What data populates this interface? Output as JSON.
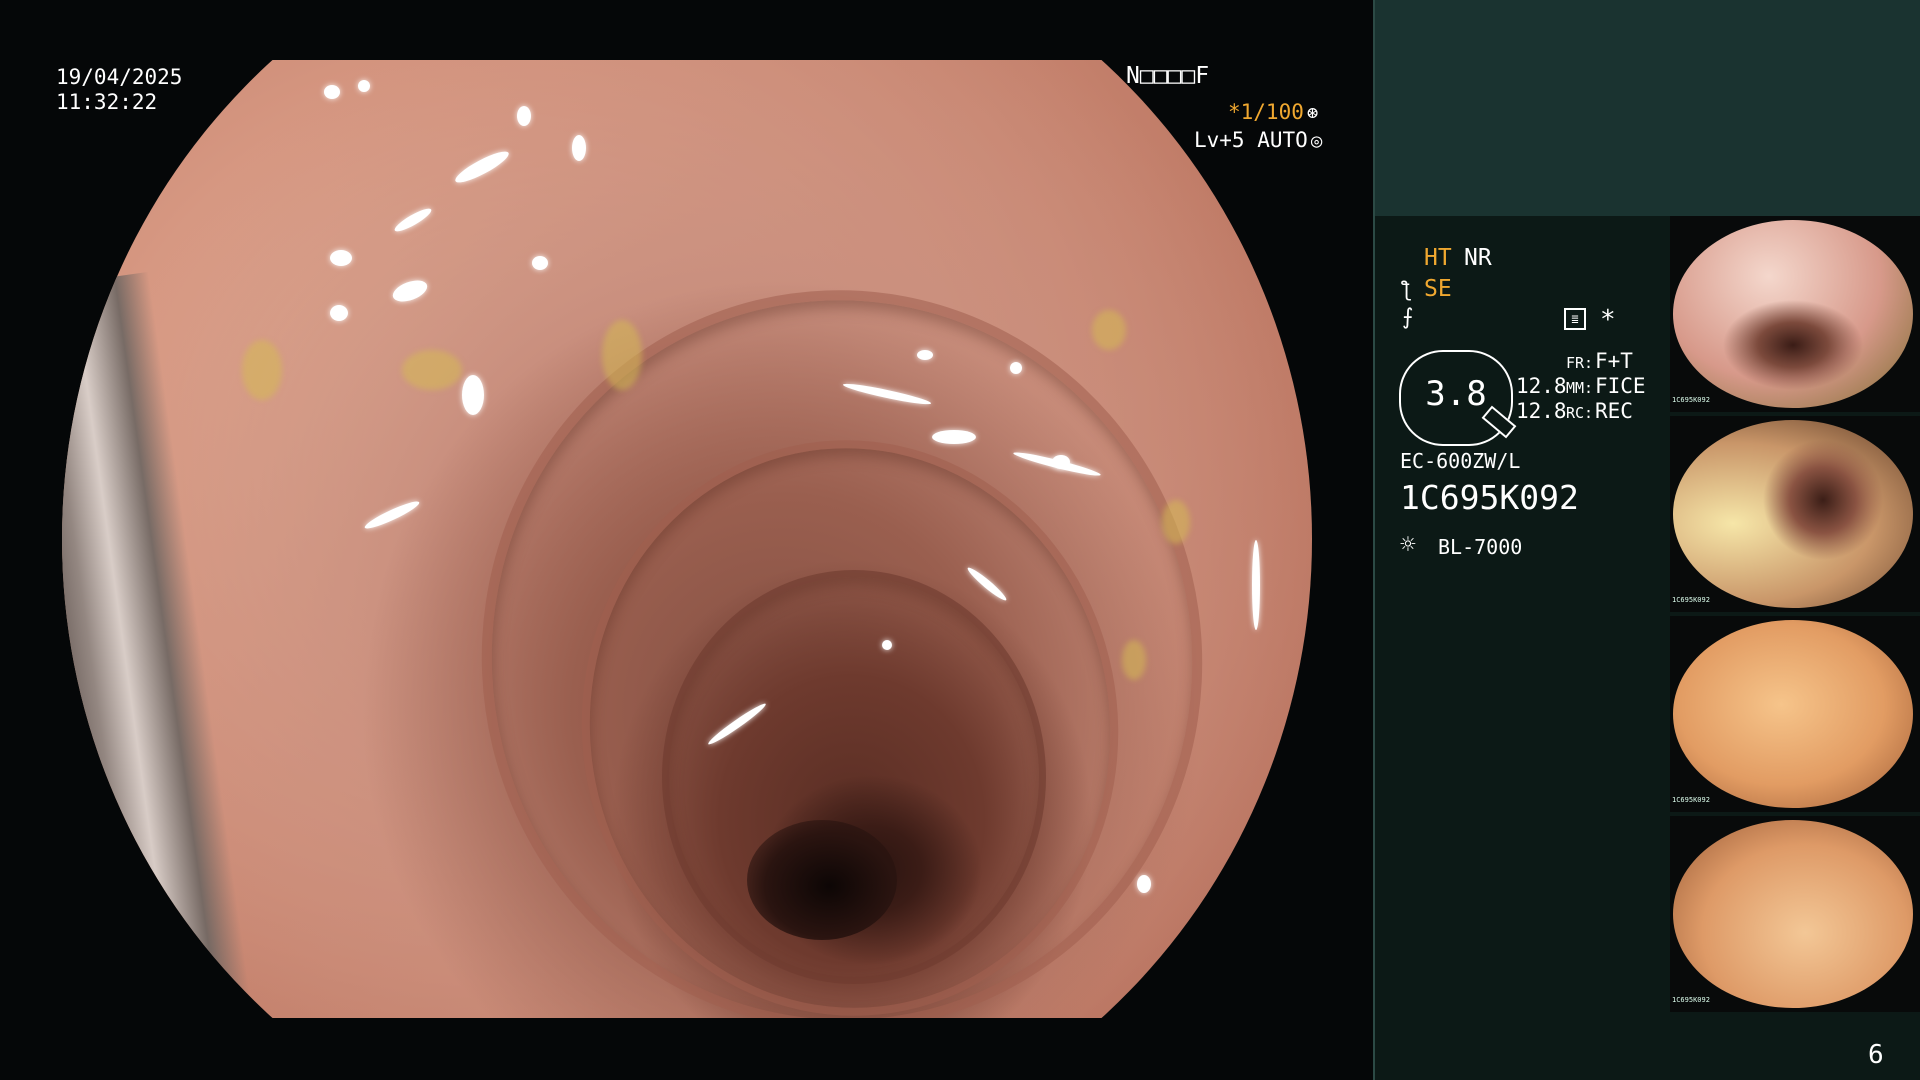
{
  "overlay": {
    "date": "19/04/2025",
    "time": "11:32:22",
    "patient_code": "N□□□□F",
    "shutter": "*1/100",
    "level": "Lv+5",
    "iris_mode": "AUTO"
  },
  "panel": {
    "ht_label": "HT",
    "nr_label": "NR",
    "se_label": "SE",
    "gauge_value": "3.8",
    "fr_key": "FR:",
    "fr_value": "F+T",
    "mm_num": "12.8",
    "mm_key": "MM:",
    "mm_value": "FICE",
    "rc_num": "12.8",
    "rc_key": "RC:",
    "rc_value": "REC",
    "scope_model": "EC-600ZW/L",
    "serial": "1C695K092",
    "light_source": "BL-7000",
    "star": "*"
  },
  "thumbnails": [
    {
      "serial": "1C695K092"
    },
    {
      "serial": "1C695K092"
    },
    {
      "serial": "1C695K092"
    },
    {
      "serial": "1C695K092"
    }
  ],
  "page_number": "6",
  "colors": {
    "accent_orange": "#f0a830",
    "panel_top": "#1a3330",
    "panel_body": "#0c1916",
    "background": "#050708"
  },
  "icons": [
    "shutter-gear-icon",
    "iris-gear-icon",
    "structure-enhance-icon",
    "color-enhance-icon",
    "memo-icon",
    "light-source-icon"
  ]
}
